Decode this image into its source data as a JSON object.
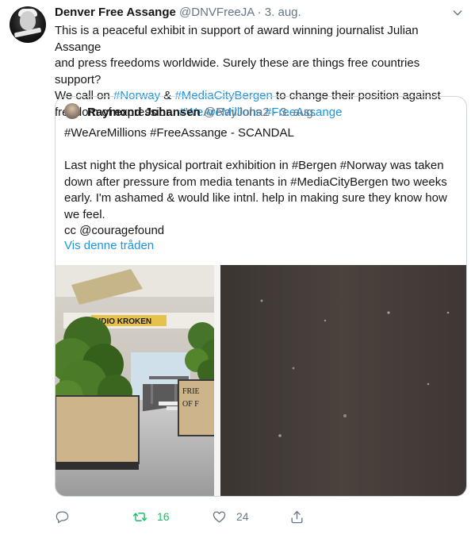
{
  "tweet": {
    "name": "Denver Free Assange",
    "handle": "@DNVFreeJA",
    "dot": "·",
    "date": "3. aug.",
    "lines": [
      [
        {
          "t": "This is a peaceful exhibit in support of award winning journalist Julian Assange"
        }
      ],
      [
        {
          "t": "and press freedoms worldwide. Surely these are things free countries support?"
        }
      ],
      [
        {
          "t": "We call on "
        },
        {
          "t": "#Norway",
          "link": true
        },
        {
          "t": " & "
        },
        {
          "t": "#MediaCityBergen",
          "link": true
        },
        {
          "t": " to change their position against"
        }
      ],
      [
        {
          "t": "freedom of expression. "
        },
        {
          "t": "#WeAreMillions",
          "link": true
        },
        {
          "t": " "
        },
        {
          "t": "#FreeAssange",
          "link": true
        }
      ]
    ]
  },
  "quote": {
    "name": "Raymond Johansen",
    "handle": "@RayJoha2",
    "dot": "·",
    "date": "3. aug.",
    "text_lines": [
      "#WeAreMillions #FreeAssange - SCANDAL",
      "",
      "Last night the physical portrait exhibition in #Bergen #Norway was taken",
      "down after pressure from media tenants in #MediaCityBergen two weeks",
      "early. I'm ashamed & would like intnl. help in making sure they know how",
      "we feel.",
      "cc @couragefound"
    ],
    "show_thread": "Vis denne tråden",
    "photo": {
      "sign_text": "UDIO KROKEN",
      "banner_text": "FRIE\nOF F"
    }
  },
  "actions": {
    "reply_count": "",
    "retweet_count": "16",
    "like_count": "24"
  },
  "colors": {
    "link": "#1b95e0",
    "retweet": "#17bf63",
    "muted": "#657786"
  },
  "icons": [
    "chevron-down-icon",
    "reply-icon",
    "retweet-icon",
    "like-icon",
    "share-icon"
  ]
}
